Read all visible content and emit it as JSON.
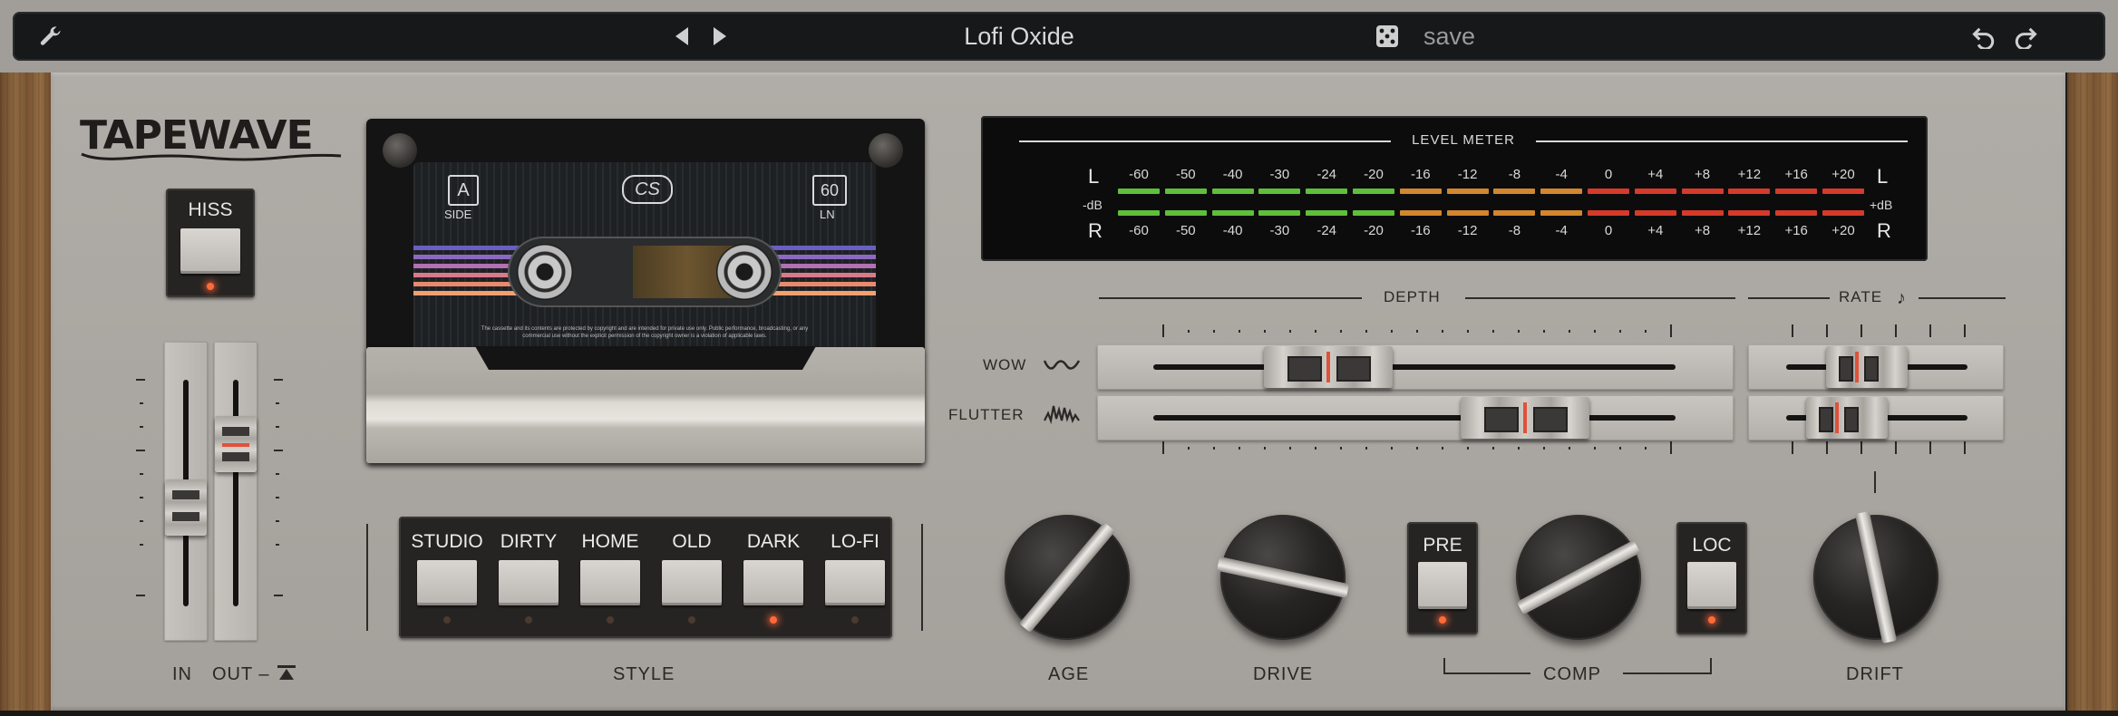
{
  "topbar": {
    "preset_name": "Lofi Oxide",
    "save_label": "save",
    "icons": [
      "wrench-icon",
      "prev-preset-icon",
      "next-preset-icon",
      "dice-icon",
      "undo-icon",
      "redo-icon"
    ]
  },
  "logo": "TAPEWAVE",
  "hiss": {
    "label": "HISS",
    "on": true
  },
  "io": {
    "in_label": "IN",
    "out_label": "OUT –",
    "link_icon": "link-icon"
  },
  "cassette": {
    "side": "A",
    "side_label": "SIDE",
    "length": "60",
    "length_label": "LN",
    "brand": "CS",
    "fine_print": "The cassette and its contents are protected by copyright and are intended for private use only. Public performance, broadcasting, or any commercial use without the explicit permission of the copyright owner is a violation of applicable laws."
  },
  "style": {
    "label": "STYLE",
    "buttons": [
      {
        "label": "STUDIO",
        "active": false
      },
      {
        "label": "DIRTY",
        "active": false
      },
      {
        "label": "HOME",
        "active": false
      },
      {
        "label": "OLD",
        "active": false
      },
      {
        "label": "DARK",
        "active": true
      },
      {
        "label": "LO-FI",
        "active": false
      }
    ]
  },
  "meter": {
    "title": "LEVEL METER",
    "left_label": "L",
    "right_label": "R",
    "left_unit": "-dB",
    "right_unit": "+dB",
    "scale": [
      "-60",
      "-50",
      "-40",
      "-30",
      "-24",
      "-20",
      "-16",
      "-12",
      "-8",
      "-4",
      "0",
      "+4",
      "+8",
      "+12",
      "+16",
      "+20"
    ],
    "colors": {
      "green": "#5fbf3a",
      "orange": "#d2862e",
      "red": "#d63a2a"
    }
  },
  "modulation": {
    "depth_label": "DEPTH",
    "rate_label": "RATE",
    "wow_label": "WOW",
    "flutter_label": "FLUTTER",
    "wow_depth": 0.28,
    "flutter_depth": 0.78,
    "wow_rate": 0.4,
    "flutter_rate": 0.2
  },
  "knobs": {
    "age": {
      "label": "AGE",
      "value": 0.7
    },
    "drive": {
      "label": "DRIVE",
      "value": 0.3
    },
    "comp": {
      "label": "COMP",
      "value": 0.7
    },
    "drift": {
      "label": "DRIFT",
      "value": 0.55
    }
  },
  "comp": {
    "pre_label": "PRE",
    "loc_label": "LOC",
    "pre_on": true,
    "loc_on": true
  }
}
